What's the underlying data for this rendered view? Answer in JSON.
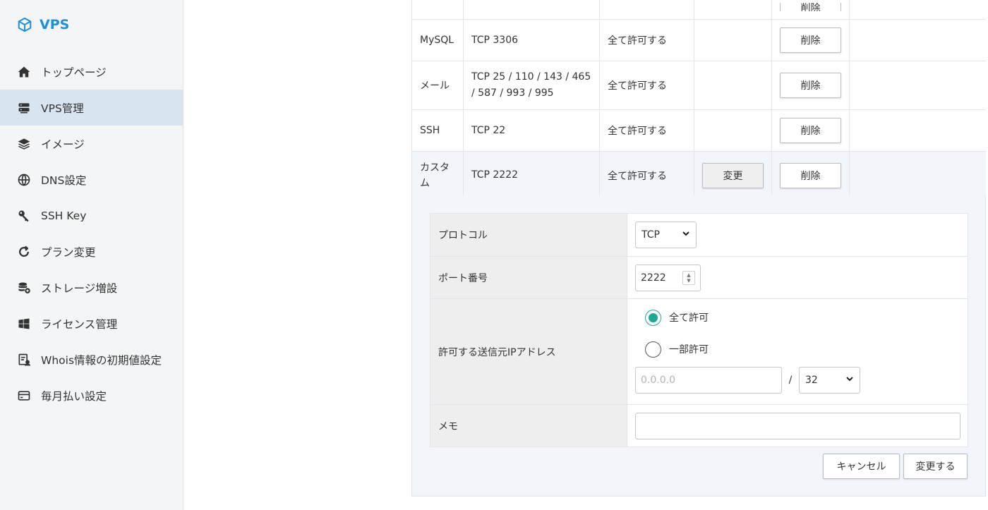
{
  "app": {
    "logo_text": "VPS",
    "accent_color": "#1f8fd6",
    "logo_icon": "cube-icon"
  },
  "sidebar": {
    "items": [
      {
        "label": "トップページ",
        "icon": "home-icon",
        "active": false
      },
      {
        "label": "VPS管理",
        "icon": "server-icon",
        "active": true
      },
      {
        "label": "イメージ",
        "icon": "layers-icon",
        "active": false
      },
      {
        "label": "DNS設定",
        "icon": "globe-icon",
        "active": false
      },
      {
        "label": "SSH Key",
        "icon": "key-icon",
        "active": false
      },
      {
        "label": "プラン変更",
        "icon": "refresh-icon",
        "active": false
      },
      {
        "label": "ストレージ増設",
        "icon": "database-add-icon",
        "active": false
      },
      {
        "label": "ライセンス管理",
        "icon": "windows-icon",
        "active": false
      },
      {
        "label": "Whois情報の初期値設定",
        "icon": "document-user-icon",
        "active": false
      },
      {
        "label": "毎月払い設定",
        "icon": "credit-card-icon",
        "active": false
      }
    ]
  },
  "rules": {
    "top_partial_button": "削除",
    "rows": [
      {
        "name": "MySQL",
        "port": "TCP 3306",
        "allow": "全て許可する",
        "edit_label": "",
        "delete_label": "削除"
      },
      {
        "name": "メール",
        "port": "TCP 25 / 110 / 143 / 465 / 587 / 993 / 995",
        "allow": "全て許可する",
        "edit_label": "",
        "delete_label": "削除"
      },
      {
        "name": "SSH",
        "port": "TCP 22",
        "allow": "全て許可する",
        "edit_label": "",
        "delete_label": "削除"
      },
      {
        "name": "カスタム",
        "port": "TCP 2222",
        "allow": "全て許可する",
        "edit_label": "変更",
        "delete_label": "削除"
      }
    ]
  },
  "edit_form": {
    "protocol": {
      "label": "プロトコル",
      "value": "TCP"
    },
    "port": {
      "label": "ポート番号",
      "value": "2222"
    },
    "source_ip": {
      "label": "許可する送信元IPアドレス",
      "option_all": "全て許可",
      "option_partial": "一部許可",
      "selected": "all",
      "ip_placeholder": "0.0.0.0",
      "slash": "/",
      "prefix_value": "32"
    },
    "memo": {
      "label": "メモ",
      "value": ""
    },
    "cancel_label": "キャンセル",
    "submit_label": "変更する",
    "radio_color": "#1fa896"
  }
}
